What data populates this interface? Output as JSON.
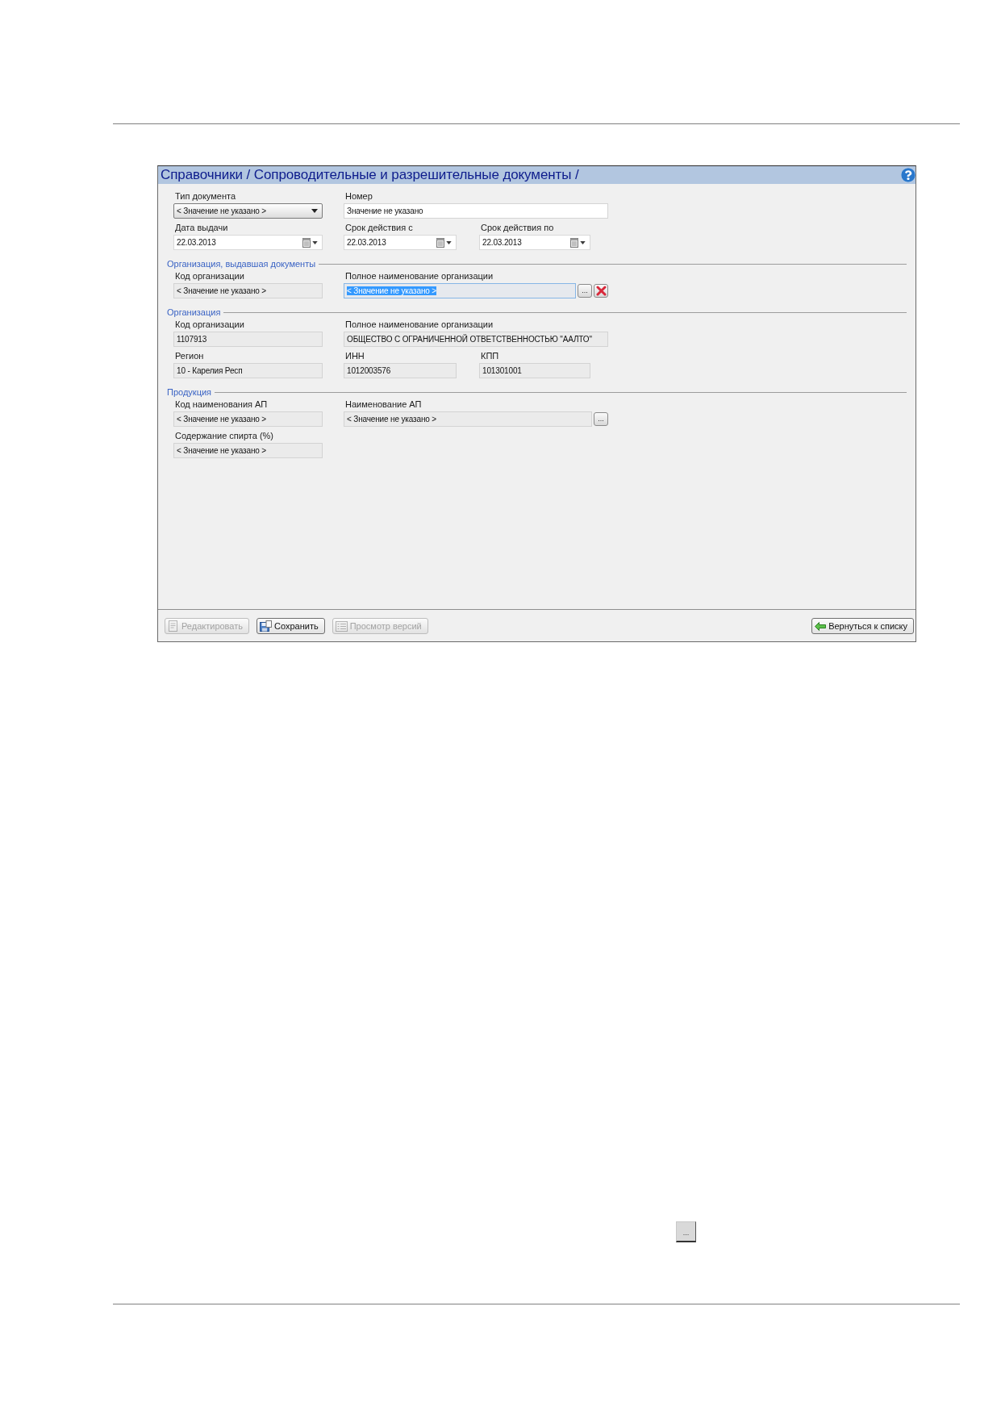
{
  "window": {
    "title": "Справочники / Сопроводительные и разрешительные документы /"
  },
  "document": {
    "rows": [
      [
        {
          "label": "Тип документа",
          "kind": "select",
          "value": "< Значение не указано >",
          "highlighted": false
        },
        {
          "label": "Номер",
          "kind": "text",
          "value": "Значение не указано",
          "highlighted": false
        }
      ],
      [
        {
          "label": "Дата выдачи",
          "kind": "date",
          "value": "22.03.2013",
          "highlighted": false
        },
        {
          "label": "Срок действия с",
          "kind": "date",
          "value": "22.03.2013",
          "highlighted": false
        },
        {
          "label": "Срок действия по",
          "kind": "date",
          "value": "22.03.2013",
          "highlighted": false
        }
      ]
    ]
  },
  "sections": [
    {
      "title": "Организация, выдавшая документы",
      "rows": [
        [
          {
            "label": "Код организации",
            "kind": "readonly",
            "value": "< Значение не указано >",
            "highlighted": false
          },
          {
            "label": "Полное наименование организации",
            "kind": "readonly",
            "value": "< Значение не указано >",
            "highlighted": true,
            "buttons": [
              {
                "kind": "browse",
                "label": "..."
              },
              {
                "kind": "clear"
              }
            ]
          }
        ]
      ]
    },
    {
      "title": "Организация",
      "rows": [
        [
          {
            "label": "Код организации",
            "kind": "readonly",
            "value": "1107913",
            "highlighted": false
          },
          {
            "label": "Полное наименование организации",
            "kind": "readonly",
            "value": "ОБЩЕСТВО С ОГРАНИЧЕННОЙ ОТВЕТСТВЕННОСТЬЮ \"ААЛТО\"",
            "highlighted": false
          }
        ],
        [
          {
            "label": "Регион",
            "kind": "readonly",
            "value": "10 - Карелия Респ",
            "highlighted": false
          },
          {
            "label": "ИНН",
            "kind": "readonly",
            "value": "1012003576",
            "highlighted": false
          },
          {
            "label": "КПП",
            "kind": "readonly",
            "value": "101301001",
            "highlighted": false
          }
        ]
      ]
    },
    {
      "title": "Продукция",
      "rows": [
        [
          {
            "label": "Код наименования АП",
            "kind": "readonly",
            "value": "< Значение не указано >",
            "highlighted": false
          },
          {
            "label": "Наименование АП",
            "kind": "readonly",
            "value": "< Значение не указано >",
            "highlighted": false,
            "buttons": [
              {
                "kind": "browse",
                "label": "..."
              }
            ]
          }
        ],
        [
          {
            "label": "Содержание спирта (%)",
            "kind": "readonly",
            "value": "< Значение не указано >",
            "highlighted": false
          }
        ]
      ]
    }
  ],
  "toolbar": {
    "left_buttons": [
      {
        "label": "Редактировать",
        "kind": "edit",
        "disabled": true
      },
      {
        "label": "Сохранить",
        "kind": "save",
        "disabled": false
      },
      {
        "label": "Просмотр версий",
        "kind": "versions",
        "disabled": true
      }
    ],
    "right_buttons": [
      {
        "label": "Вернуться к списку",
        "kind": "back",
        "disabled": false
      }
    ]
  },
  "page_button": {
    "label": "..."
  }
}
